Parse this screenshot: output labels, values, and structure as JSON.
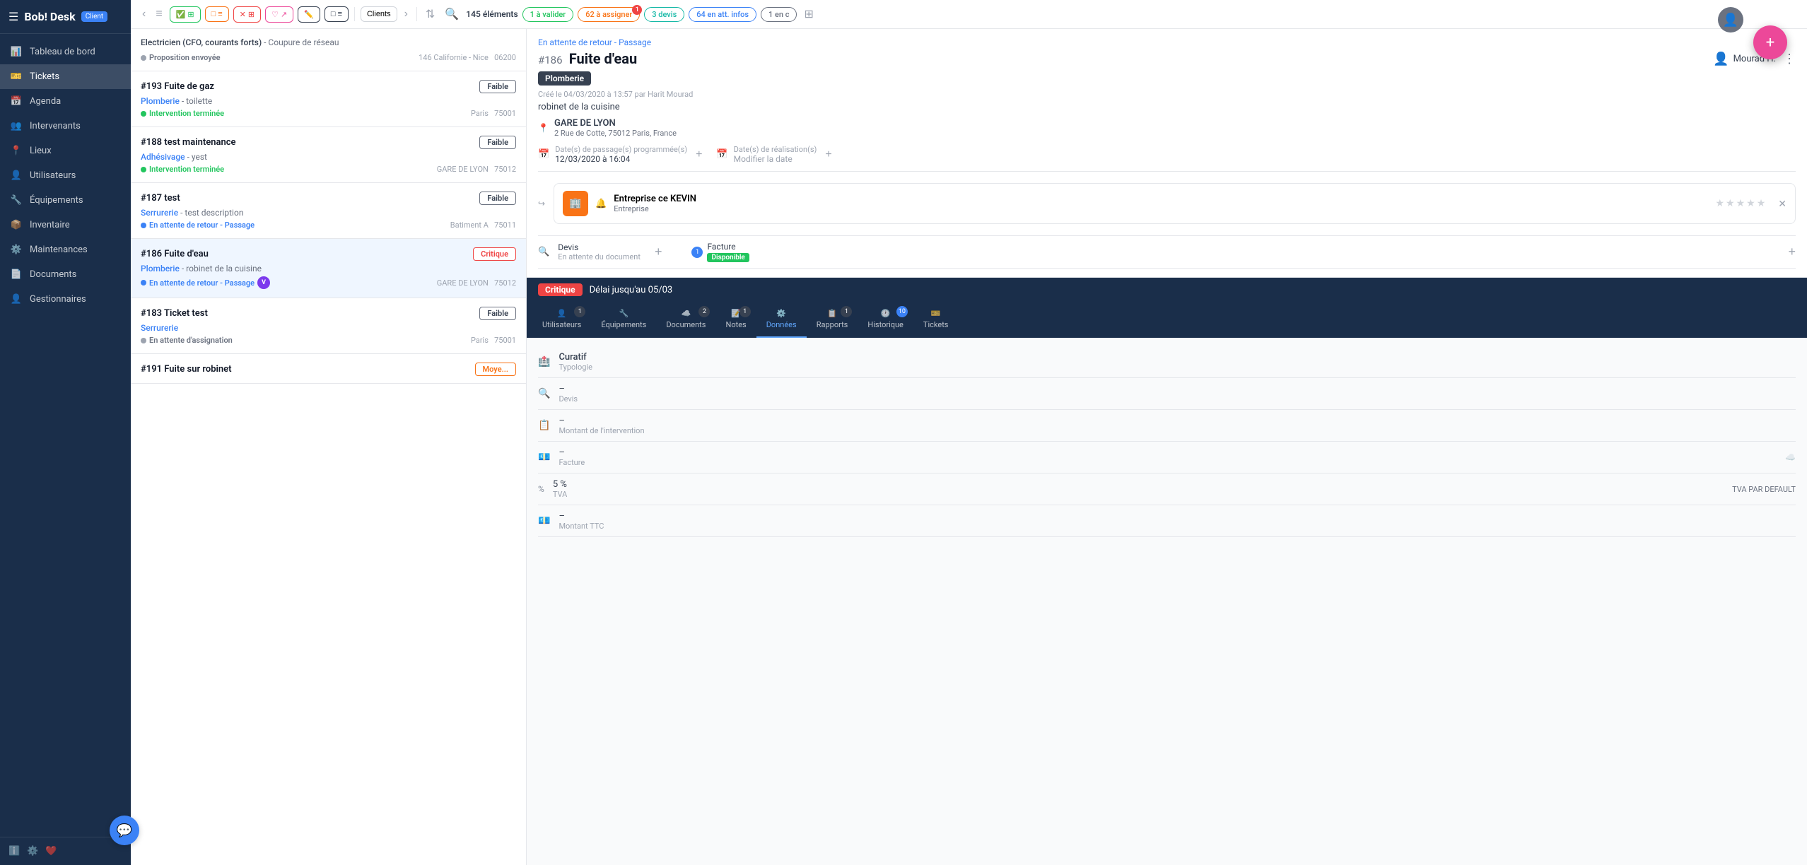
{
  "app": {
    "name": "Bob! Desk",
    "badge": "Client"
  },
  "sidebar": {
    "items": [
      {
        "id": "dashboard",
        "label": "Tableau de bord",
        "icon": "📊"
      },
      {
        "id": "tickets",
        "label": "Tickets",
        "icon": "🎫",
        "active": true
      },
      {
        "id": "agenda",
        "label": "Agenda",
        "icon": "📅"
      },
      {
        "id": "intervenants",
        "label": "Intervenants",
        "icon": "👥"
      },
      {
        "id": "lieux",
        "label": "Lieux",
        "icon": "📍"
      },
      {
        "id": "utilisateurs",
        "label": "Utilisateurs",
        "icon": "👤"
      },
      {
        "id": "equipements",
        "label": "Équipements",
        "icon": "🔧"
      },
      {
        "id": "inventaire",
        "label": "Inventaire",
        "icon": "📦"
      },
      {
        "id": "maintenances",
        "label": "Maintenances",
        "icon": "⚙️"
      },
      {
        "id": "documents",
        "label": "Documents",
        "icon": "📄"
      },
      {
        "id": "gestionnaires",
        "label": "Gestionnaires",
        "icon": "👤"
      }
    ]
  },
  "toolbar": {
    "elements_count": "145 éléments",
    "filter_valider": "1 à valider",
    "filter_assigner": "62 à assigner",
    "filter_assigner_notif": "1",
    "filter_devis": "3 devis",
    "filter_att_infos": "64 en att. infos",
    "filter_en_c": "1 en c",
    "client_btn": "Clients"
  },
  "tickets": [
    {
      "id": "193",
      "title": "Fuite de gaz",
      "category": "Électricien (CFO, courants forts)",
      "description": "Coupure de réseau",
      "subtitle_cat": "Plomberie",
      "subtitle_detail": "toilette",
      "status": "Intervention terminée",
      "status_type": "green",
      "location": "Paris",
      "postal": "75001",
      "priority": "Faible",
      "priority_type": "faible"
    },
    {
      "id": "188",
      "title": "test maintenance",
      "category": "",
      "description": "",
      "subtitle_cat": "Adhésivage",
      "subtitle_detail": "yest",
      "status": "Intervention terminée",
      "status_type": "green",
      "location": "GARE DE LYON",
      "postal": "75012",
      "priority": "Faible",
      "priority_type": "faible"
    },
    {
      "id": "187",
      "title": "test",
      "category": "",
      "description": "",
      "subtitle_cat": "Serrurerie",
      "subtitle_detail": "test description",
      "status": "En attente de retour - Passage",
      "status_type": "blue",
      "location": "Batiment A",
      "postal": "75011",
      "priority": "Faible",
      "priority_type": "faible"
    },
    {
      "id": "186",
      "title": "Fuite d'eau",
      "category": "",
      "description": "",
      "subtitle_cat": "Plomberie",
      "subtitle_detail": "robinet de la cuisine",
      "status": "En attente de retour - Passage",
      "status_type": "blue",
      "location": "GARE DE LYON",
      "postal": "75012",
      "priority": "Critique",
      "priority_type": "critique",
      "selected": true
    },
    {
      "id": "183",
      "title": "Ticket test",
      "category": "",
      "description": "",
      "subtitle_cat": "Serrurerie",
      "subtitle_detail": "",
      "status": "En attente d'assignation",
      "status_type": "gray",
      "location": "Paris",
      "postal": "75001",
      "priority": "Faible",
      "priority_type": "faible"
    }
  ],
  "detail": {
    "status_label": "En attente de retour - Passage",
    "ticket_number": "#186",
    "title": "Fuite d'eau",
    "category_badge": "Plomberie",
    "created_label": "Créé le 04/03/2020 à 13:57 par",
    "created_by": "Harit Mourad",
    "description": "robinet de la cuisine",
    "location_name": "GARE DE LYON",
    "location_address": "2 Rue de Cotte, 75012 Paris, France",
    "dates_passage_label": "Date(s) de passage(s) programmée(s)",
    "dates_passage_value": "12/03/2020 à 16:04",
    "dates_realisation_label": "Date(s) de réalisation(s)",
    "dates_realisation_sublabel": "Modifier la date",
    "assignee_name": "Mourad H.",
    "intervenant_name": "Entreprise ce KEVIN",
    "intervenant_type": "Entreprise",
    "devis_label": "Devis",
    "devis_status": "En attente du document",
    "facture_label": "Facture",
    "facture_count": "1",
    "facture_status": "Disponible",
    "critique_label": "Critique",
    "deadline_label": "Délai jusqu'au 05/03"
  },
  "tabs": [
    {
      "id": "utilisateurs",
      "label": "Utilisateurs",
      "icon": "👤",
      "count": "1"
    },
    {
      "id": "equipements",
      "label": "Équipements",
      "icon": "🔧",
      "count": ""
    },
    {
      "id": "documents",
      "label": "Documents",
      "icon": "☁️",
      "count": "2"
    },
    {
      "id": "notes",
      "label": "Notes",
      "icon": "📝",
      "count": "1"
    },
    {
      "id": "donnees",
      "label": "Données",
      "icon": "⚙️",
      "count": "",
      "active": true
    },
    {
      "id": "rapports",
      "label": "Rapports",
      "icon": "📋",
      "count": "1"
    },
    {
      "id": "historique",
      "label": "Historique",
      "icon": "🕐",
      "count": "10"
    },
    {
      "id": "tickets",
      "label": "Tickets",
      "icon": "🎫",
      "count": ""
    }
  ],
  "donnees": {
    "rows": [
      {
        "icon": "🏥",
        "label": "Curatif",
        "sublabel": "Typologie",
        "value": ""
      },
      {
        "icon": "🔍",
        "label": "–",
        "sublabel": "Devis",
        "value": ""
      },
      {
        "icon": "📋",
        "label": "–",
        "sublabel": "Montant de l'intervention",
        "value": ""
      },
      {
        "icon": "💶",
        "label": "–",
        "sublabel": "Facture",
        "value": ""
      },
      {
        "icon": "%",
        "label": "5 %",
        "sublabel": "TVA",
        "value": "TVA PAR DEFAULT"
      },
      {
        "icon": "💶",
        "label": "–",
        "sublabel": "Montant TTC",
        "value": ""
      }
    ]
  },
  "icons": {
    "menu": "☰",
    "chevron_left": "‹",
    "list": "≡",
    "search": "🔍",
    "sort": "⇅",
    "more": "⋮",
    "plus": "+",
    "close": "✕",
    "location_pin": "📍",
    "calendar": "📅",
    "person": "👤",
    "bell": "🔔",
    "cloud": "☁️",
    "star": "★",
    "chevron_right": "›",
    "filter": "⊞"
  },
  "colors": {
    "sidebar_bg": "#1a2e4a",
    "accent_blue": "#3b82f6",
    "green": "#22c55e",
    "red": "#ef4444",
    "orange": "#f97316",
    "pink": "#ec4899",
    "dark_navy": "#1a2e4a"
  }
}
